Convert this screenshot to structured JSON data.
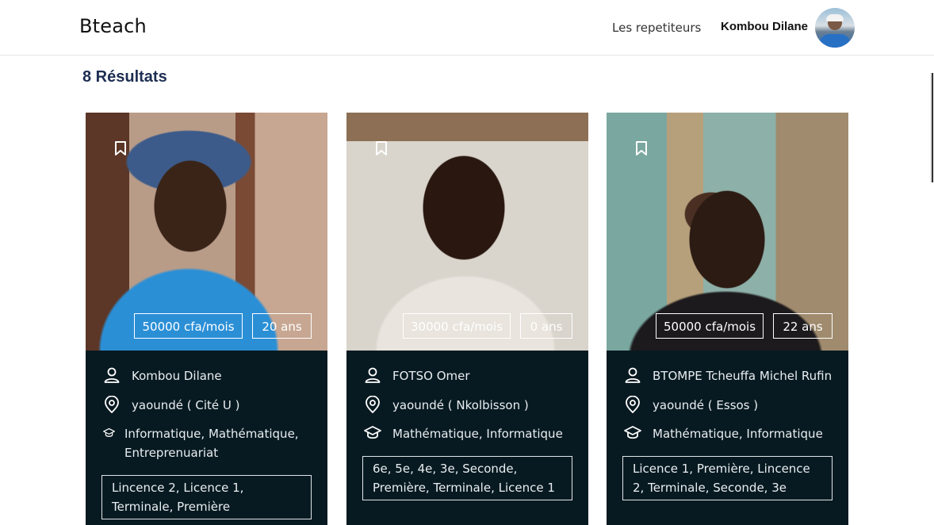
{
  "header": {
    "logo": "Bteach",
    "nav_link": "Les repetiteurs",
    "user_name": "Kombou Dilane"
  },
  "results_label": "8 Résultats",
  "cards": [
    {
      "price": "50000 cfa/mois",
      "age": "20 ans",
      "name": "Kombou Dilane",
      "location": "yaoundé ( Cité U )",
      "subjects": "Informatique, Mathématique, Entreprenuariat",
      "levels": "Lincence 2, Licence 1, Terminale, Première"
    },
    {
      "price": "30000 cfa/mois",
      "age": "0 ans",
      "name": "FOTSO Omer",
      "location": "yaoundé ( Nkolbisson )",
      "subjects": "Mathématique, Informatique",
      "levels": "6e, 5e, 4e, 3e, Seconde, Première, Terminale, Licence 1"
    },
    {
      "price": "50000 cfa/mois",
      "age": "22 ans",
      "name": "BTOMPE Tcheuffa Michel Rufin",
      "location": "yaoundé ( Essos )",
      "subjects": "Mathématique, Informatique",
      "levels": "Licence 1, Première, Lincence 2, Terminale, Seconde, 3e"
    }
  ],
  "icons": {
    "bookmark": "bookmark-icon",
    "person": "person-icon",
    "location": "location-pin-icon",
    "subjects": "graduation-cap-icon"
  },
  "colors": {
    "card_background": "#081a21",
    "results_heading": "#1d2e52"
  }
}
